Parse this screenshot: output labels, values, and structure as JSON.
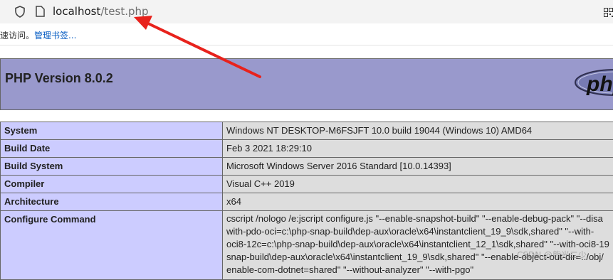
{
  "browser": {
    "url_host": "localhost",
    "url_path": "/test.php",
    "favorites_text": "速访问。",
    "favorites_link": "管理书签..."
  },
  "phpinfo": {
    "title": "PHP Version 8.0.2",
    "logo_text": "php",
    "rows": [
      {
        "key": "System",
        "value": "Windows NT DESKTOP-M6FSJFT 10.0 build 19044 (Windows 10) AMD64"
      },
      {
        "key": "Build Date",
        "value": "Feb 3 2021 18:29:10"
      },
      {
        "key": "Build System",
        "value": "Microsoft Windows Server 2016 Standard [10.0.14393]"
      },
      {
        "key": "Compiler",
        "value": "Visual C++ 2019"
      },
      {
        "key": "Architecture",
        "value": "x64"
      }
    ],
    "configure": {
      "key": "Configure Command",
      "lines": [
        "cscript /nologo /e:jscript configure.js \"--enable-snapshot-build\" \"--enable-debug-pack\" \"--disa",
        "with-pdo-oci=c:\\php-snap-build\\dep-aux\\oracle\\x64\\instantclient_19_9\\sdk,shared\" \"--with-",
        "oci8-12c=c:\\php-snap-build\\dep-aux\\oracle\\x64\\instantclient_12_1\\sdk,shared\" \"--with-oci8-19",
        "snap-build\\dep-aux\\oracle\\x64\\instantclient_19_9\\sdk,shared\" \"--enable-object-out-dir=../obj/",
        "enable-com-dotnet=shared\" \"--without-analyzer\" \"--with-pgo\""
      ]
    }
  },
  "annotation": {
    "color": "#e8221c"
  },
  "watermark": "CSDN @熊光二少"
}
